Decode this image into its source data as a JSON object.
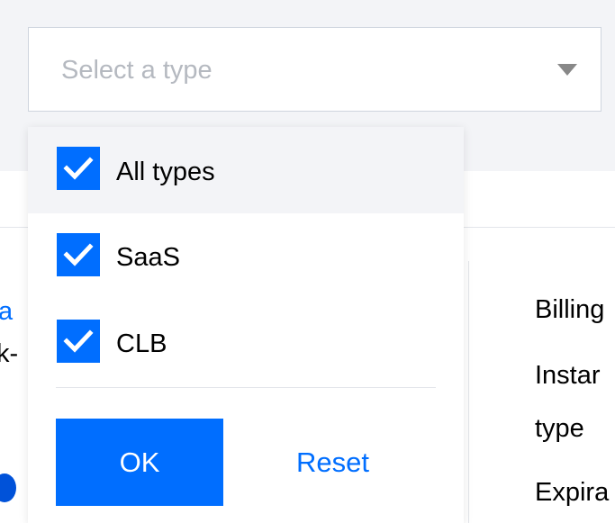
{
  "select": {
    "placeholder": "Select a type"
  },
  "dropdown": {
    "options": [
      {
        "label": "All types",
        "checked": true,
        "highlighted": true
      },
      {
        "label": "SaaS",
        "checked": true,
        "highlighted": false
      },
      {
        "label": "CLB",
        "checked": true,
        "highlighted": false
      }
    ],
    "ok_label": "OK",
    "reset_label": "Reset"
  },
  "background": {
    "right_labels": [
      "Billing",
      "Instar",
      "type",
      "Expira"
    ],
    "left_fragments": [
      "a",
      "k-"
    ]
  },
  "colors": {
    "accent": "#006eff",
    "checkbox": "#006eff",
    "placeholder": "#b5b9c0",
    "highlight_bg": "#f3f4f7",
    "blue_dot": "#0052d9"
  },
  "icons": {
    "caret": "caret-down-icon",
    "check": "check-icon"
  }
}
